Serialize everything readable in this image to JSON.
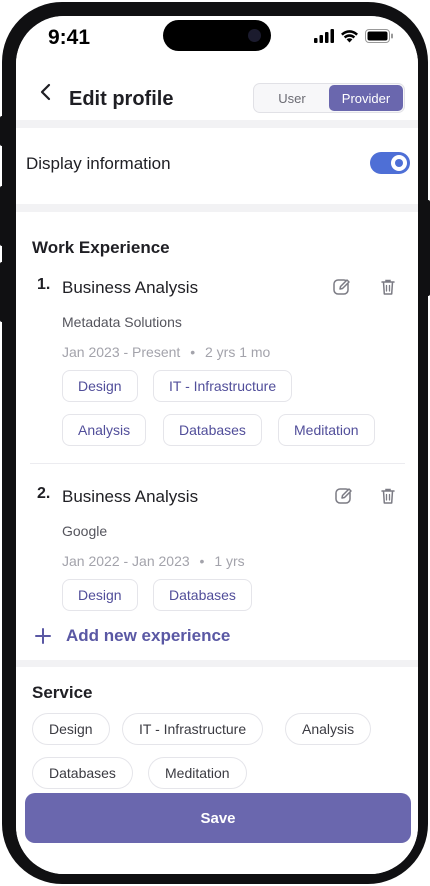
{
  "status_bar": {
    "time": "9:41"
  },
  "header": {
    "title": "Edit profile",
    "segment": {
      "options": [
        "User",
        "Provider"
      ],
      "selected": "Provider"
    }
  },
  "display": {
    "label": "Display information",
    "enabled": true
  },
  "work": {
    "title": "Work Experience",
    "items": [
      {
        "number": "1.",
        "role": "Business Analysis",
        "company": "Metadata Solutions",
        "dates": "Jan 2023 - Present",
        "duration": "2 yrs 1 mo",
        "tags": [
          "Design",
          "IT - Infrastructure",
          "Analysis",
          "Databases",
          "Meditation"
        ]
      },
      {
        "number": "2.",
        "role": "Business Analysis",
        "company": "Google",
        "dates": "Jan 2022 - Jan 2023",
        "duration": "1 yrs",
        "tags": [
          "Design",
          "Databases"
        ]
      }
    ],
    "add_label": "Add new experience"
  },
  "service": {
    "title": "Service",
    "pills": [
      "Design",
      "IT - Infrastructure",
      "Analysis",
      "Databases",
      "Meditation"
    ]
  },
  "save_label": "Save",
  "colors": {
    "accent": "#6a67ae",
    "toggle": "#4e6fd6"
  }
}
